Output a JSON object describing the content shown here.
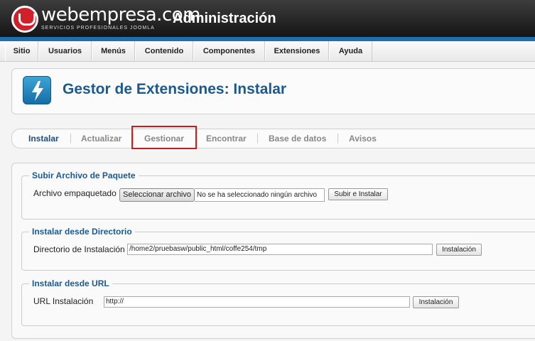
{
  "header": {
    "logo_text": "webempresa.com",
    "logo_sub": "SERVICIOS PROFESIONALES JOOMLA",
    "title": "Administración"
  },
  "menu": {
    "items": [
      "Sitio",
      "Usuarios",
      "Menús",
      "Contenido",
      "Componentes",
      "Extensiones",
      "Ayuda"
    ]
  },
  "page": {
    "title": "Gestor de Extensiones: Instalar",
    "icon": "lightning-icon"
  },
  "tabs": {
    "items": [
      "Instalar",
      "Actualizar",
      "Gestionar",
      "Encontrar",
      "Base de datos",
      "Avisos"
    ],
    "active": "Instalar",
    "highlighted": "Gestionar"
  },
  "upload": {
    "legend": "Subir Archivo de Paquete",
    "label": "Archivo empaquetado",
    "file_button": "Seleccionar archivo",
    "file_status": "No se ha seleccionado ningún archivo",
    "submit": "Subir e Instalar"
  },
  "directory": {
    "legend": "Instalar desde Directorio",
    "label": "Directorio de Instalación",
    "value": "/home2/pruebasw/public_html/coffe254/tmp",
    "submit": "Instalación"
  },
  "url": {
    "legend": "Instalar desde URL",
    "label": "URL Instalación",
    "value": "http://",
    "submit": "Instalación"
  },
  "colors": {
    "brand_red": "#d0202a",
    "title_blue": "#1a5a91",
    "highlight": "#d0191f",
    "header_strip": "#1f6fb0"
  }
}
